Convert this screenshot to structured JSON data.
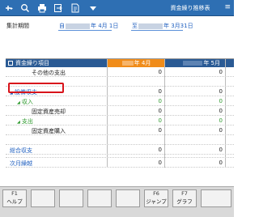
{
  "toolbar": {
    "title": "資金繰り推移表",
    "icons": [
      "add-icon",
      "zoom-icon",
      "print-icon",
      "export-icon",
      "pdf-icon",
      "dropdown-icon"
    ]
  },
  "period": {
    "label": "集計期間",
    "from_prefix": "自",
    "from_suffix": "年  4月 1日",
    "to_prefix": "至",
    "to_suffix": "年  3月31日"
  },
  "grid": {
    "header": {
      "item": "資金繰り項目",
      "month1": "年  4月",
      "month2": "年  5月"
    },
    "rows": [
      {
        "label": "その他の支出",
        "v1": "0",
        "v2": "0"
      },
      {
        "label": "",
        "v1": "",
        "v2": ""
      },
      {
        "label": "設備収支",
        "v1": "0",
        "v2": "0"
      },
      {
        "label": "収入",
        "v1": "0",
        "v2": "0"
      },
      {
        "label": "固定資産売却",
        "v1": "0",
        "v2": "0"
      },
      {
        "label": "支出",
        "v1": "0",
        "v2": "0"
      },
      {
        "label": "固定資産購入",
        "v1": "0",
        "v2": "0"
      },
      {
        "label": "",
        "v1": "",
        "v2": ""
      },
      {
        "label": "総合収支",
        "v1": "0",
        "v2": "0"
      },
      {
        "label": "",
        "v1": "",
        "v2": ""
      },
      {
        "label": "次月繰越",
        "v1": "0",
        "v2": "0"
      }
    ]
  },
  "fkeys": [
    {
      "num": "F1",
      "label": "ヘルプ"
    },
    {
      "num": "",
      "label": ""
    },
    {
      "num": "",
      "label": ""
    },
    {
      "num": "",
      "label": ""
    },
    {
      "num": "",
      "label": ""
    },
    {
      "num": "F6",
      "label": "ジャンプ"
    },
    {
      "num": "F7",
      "label": "グラフ"
    },
    {
      "num": "",
      "label": ""
    }
  ]
}
